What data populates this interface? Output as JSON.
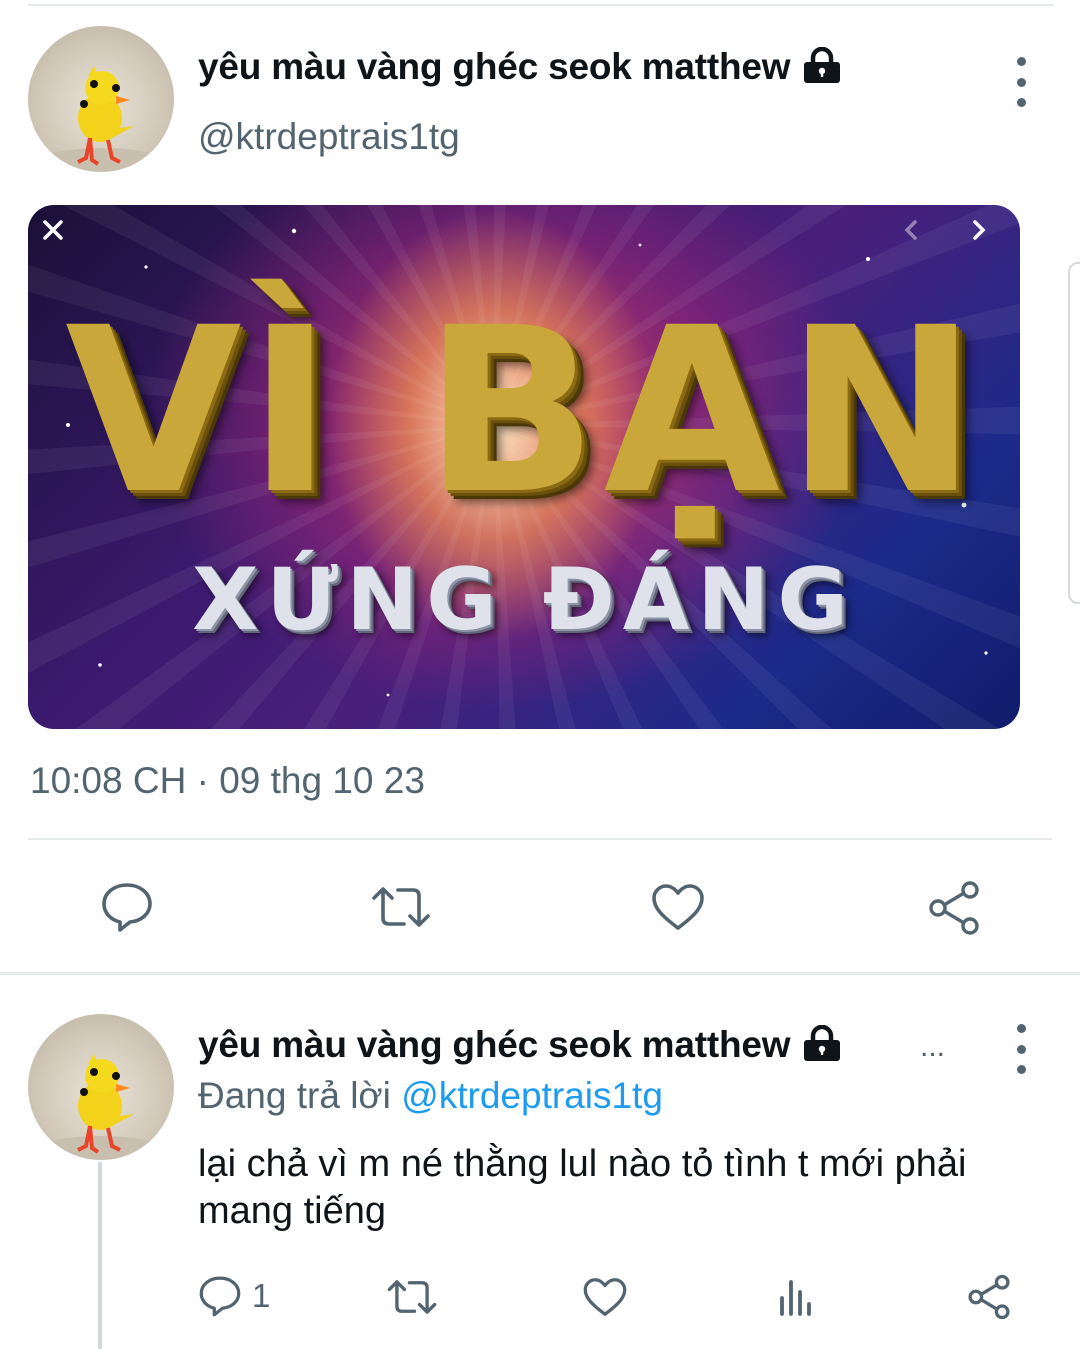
{
  "tweet": {
    "display_name": "yêu màu vàng ghéc seok matthew",
    "handle": "@ktrdeptrais1tg",
    "media": {
      "title_big": "VÌ BẠN",
      "title_small": "XỨNG ĐÁNG"
    },
    "timestamp": "10:08 CH · 09 thg 10 23"
  },
  "reply": {
    "display_name": "yêu màu vàng ghéc seok matthew",
    "ellipsis": "...",
    "replying_prefix": "Đang trả lời",
    "replying_to": "@ktrdeptrais1tg",
    "text": "lại chả vì m né thằng lul nào tỏ tình t mới phải mang tiếng",
    "reply_count": "1"
  },
  "icons": [
    "lock-icon",
    "more-icon",
    "close-icon",
    "chevron-left-icon",
    "chevron-right-icon",
    "reply-icon",
    "retweet-icon",
    "like-icon",
    "share-icon",
    "analytics-icon"
  ],
  "colors": {
    "text": "#0f1419",
    "secondary": "#536471",
    "link": "#1d9bf0",
    "divider": "#e6e9ec"
  }
}
